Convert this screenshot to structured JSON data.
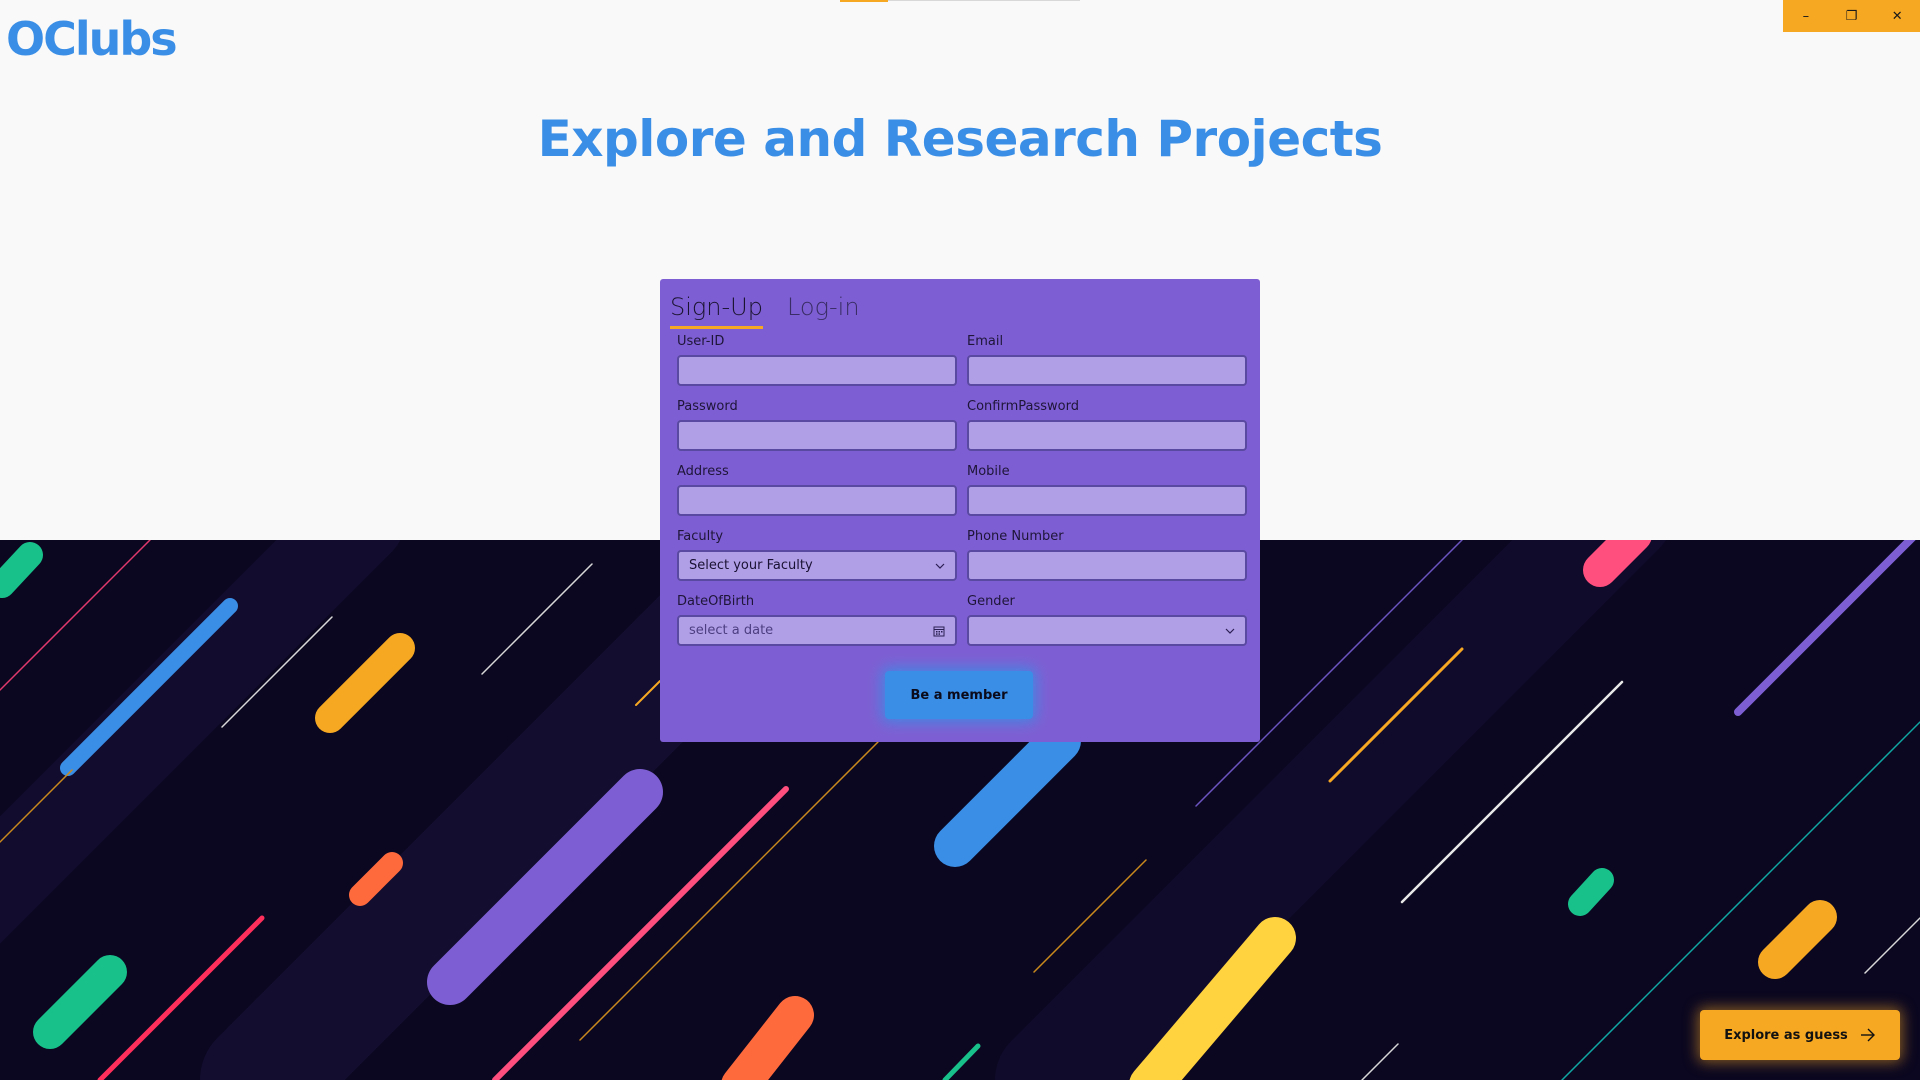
{
  "app": {
    "logo": "OClubs",
    "headline": "Explore and Research Projects"
  },
  "window_controls": {
    "minimize": "–",
    "restore": "❐",
    "close": "✕"
  },
  "tabs": [
    {
      "label": "Sign-Up",
      "active": true
    },
    {
      "label": "Log-in",
      "active": false
    }
  ],
  "form": {
    "user_id": {
      "label": "User-ID",
      "value": ""
    },
    "email": {
      "label": "Email",
      "value": ""
    },
    "password": {
      "label": "Password",
      "value": ""
    },
    "confirm_password": {
      "label": "ConfirmPassword",
      "value": ""
    },
    "address": {
      "label": "Address",
      "value": ""
    },
    "mobile": {
      "label": "Mobile",
      "value": ""
    },
    "faculty": {
      "label": "Faculty",
      "selected": "Select your Faculty"
    },
    "phone_number": {
      "label": "Phone Number",
      "value": ""
    },
    "date_of_birth": {
      "label": "DateOfBirth",
      "placeholder": "select a date"
    },
    "gender": {
      "label": "Gender",
      "selected": ""
    },
    "submit_label": "Be a member"
  },
  "guest_button": {
    "label": "Explore as guess"
  },
  "colors": {
    "accent_blue": "#3a8ee6",
    "accent_orange": "#f7a823",
    "form_bg": "#7e5fd3",
    "input_bg": "#b09ee7",
    "dark_bg": "#0b0720"
  }
}
